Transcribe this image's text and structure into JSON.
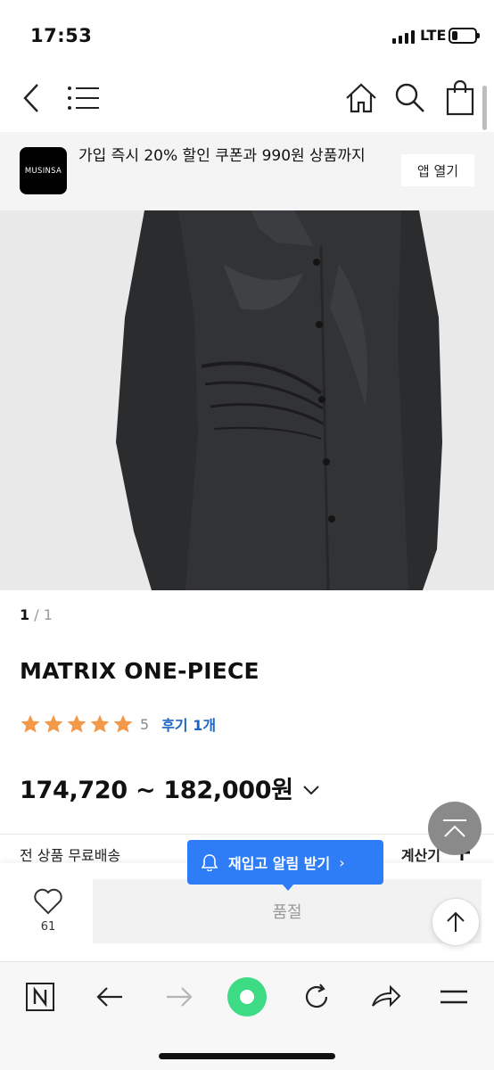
{
  "status_bar": {
    "time": "17:53",
    "network": "LTE",
    "battery_level": 0.25
  },
  "top_nav": {
    "icons": [
      "back-arrow-icon",
      "menu-icon",
      "home-icon",
      "search-icon",
      "shopping-bag-icon"
    ]
  },
  "app_banner": {
    "logo_text": "MUSINSA",
    "message": "가입 즉시 20% 할인 쿠폰과 990원 상품까지",
    "open_app_label": "앱 열기"
  },
  "gallery": {
    "current": "1",
    "separator": "/",
    "total": "1"
  },
  "product": {
    "title": "MATRIX ONE-PIECE",
    "rating": 5,
    "rating_text": "5",
    "review_link": "후기 1개",
    "price": "174,720 ~ 182,000원"
  },
  "shipping": {
    "label": "전 상품 무료배송",
    "calculator_label": "계산기"
  },
  "bottom_bar": {
    "like_count": "61",
    "soldout_label": "품절",
    "restock_tooltip": "재입고 알림 받기",
    "restock_chevron": "›"
  },
  "colors": {
    "accent_blue": "#2f7df6",
    "link_blue": "#1a66c7",
    "star": "#f2994a",
    "sync_green": "#3ddc84"
  }
}
